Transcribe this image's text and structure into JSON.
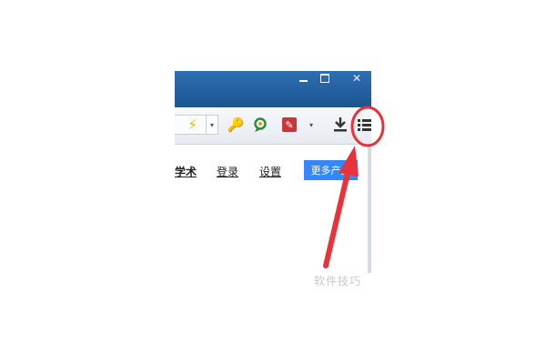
{
  "window": {
    "minimize_glyph": "",
    "close_glyph": "✕"
  },
  "toolbar": {
    "bolt_glyph": "⚡",
    "caret_glyph": "▾",
    "key_glyph": "🔑",
    "tool_glyph": "✎",
    "menu_caret_glyph": "▾",
    "icons": [
      "lightning-icon",
      "key-icon",
      "refresh-icon",
      "tools-icon",
      "download-icon",
      "list-icon"
    ]
  },
  "nav": {
    "xueshu": "学术",
    "denglu": "登录",
    "shezhi": "设置",
    "more_products": "更多产品"
  },
  "watermark": "软件技巧",
  "colors": {
    "titlebar": "#2a67a8",
    "more_products_bg": "#3388ff",
    "annotation_red": "#e8333a"
  }
}
